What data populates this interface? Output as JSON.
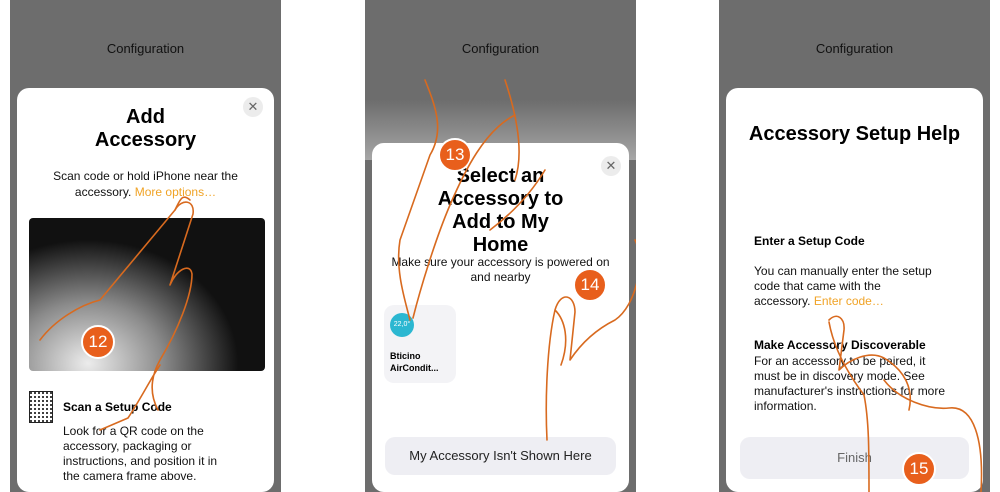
{
  "screen1": {
    "header_title": "Configuration",
    "title": "Add Accessory",
    "subtitle": "Scan code or hold iPhone near the accessory.",
    "more_options_link": "More options…",
    "step_badge": "12",
    "scan_title": "Scan a Setup Code",
    "scan_body": "Look for a QR code on the accessory, packaging or instructions, and position it in the camera frame above.",
    "close_glyph": "✕"
  },
  "screen2": {
    "header_title": "Configuration",
    "title": "Select an Accessory to Add to My Home",
    "subtitle": "Make sure your accessory is powered on and nearby",
    "accessory_temp": "22,0°",
    "accessory_name_line1": "Bticino",
    "accessory_name_line2": "AirCondit...",
    "not_shown_button": "My Accessory Isn't Shown Here",
    "step_badge_a": "13",
    "step_badge_b": "14",
    "close_glyph": "✕",
    "accessory_color": "#2bb7d1"
  },
  "screen3": {
    "header_title": "Configuration",
    "title": "Accessory Setup Help",
    "section1_title": "Enter a Setup Code",
    "section1_body": "You can manually enter the setup code that came with the accessory.",
    "enter_code_link": "Enter code…",
    "section2_title": "Make Accessory Discoverable",
    "section2_body": "For an accessory to be paired, it must be in discovery mode. See manufacturer's instructions for more information.",
    "finish_button": "Finish",
    "step_badge": "15"
  },
  "colors": {
    "accent_link": "#f0a326",
    "badge": "#e85f1c",
    "annotation_stroke": "#d86a1f",
    "backdrop": "#6d6d6d"
  }
}
